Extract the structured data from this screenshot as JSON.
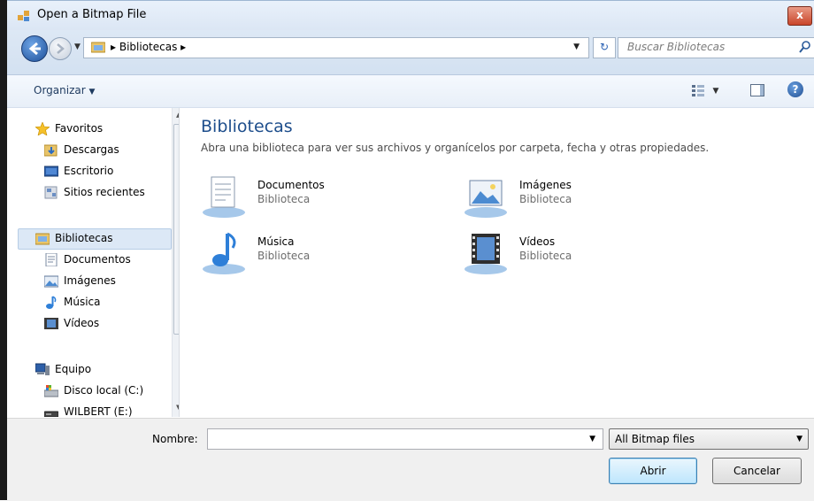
{
  "window": {
    "title": "Open a Bitmap File",
    "close_label": "x"
  },
  "addressbar": {
    "crumb": "Bibliotecas",
    "search_placeholder": "Buscar Bibliotecas"
  },
  "toolbar": {
    "organize_label": "Organizar",
    "help_label": "?"
  },
  "navpane": {
    "favorites": "Favoritos",
    "downloads": "Descargas",
    "desktop": "Escritorio",
    "recent": "Sitios recientes",
    "libraries": "Bibliotecas",
    "documents": "Documentos",
    "pictures": "Imágenes",
    "music": "Música",
    "videos": "Vídeos",
    "computer": "Equipo",
    "local_disk": "Disco local (C:)",
    "drive_e": "WILBERT (E:)"
  },
  "content": {
    "title": "Bibliotecas",
    "subtitle": "Abra una biblioteca para ver sus archivos y organícelos por carpeta, fecha y otras propiedades.",
    "libraries": [
      {
        "name": "Documentos",
        "type": "Biblioteca"
      },
      {
        "name": "Imágenes",
        "type": "Biblioteca"
      },
      {
        "name": "Música",
        "type": "Biblioteca"
      },
      {
        "name": "Vídeos",
        "type": "Biblioteca"
      }
    ]
  },
  "bottom": {
    "name_label": "Nombre:",
    "name_value": "",
    "filter_value": "All Bitmap files",
    "open_label": "Abrir",
    "cancel_label": "Cancelar"
  }
}
